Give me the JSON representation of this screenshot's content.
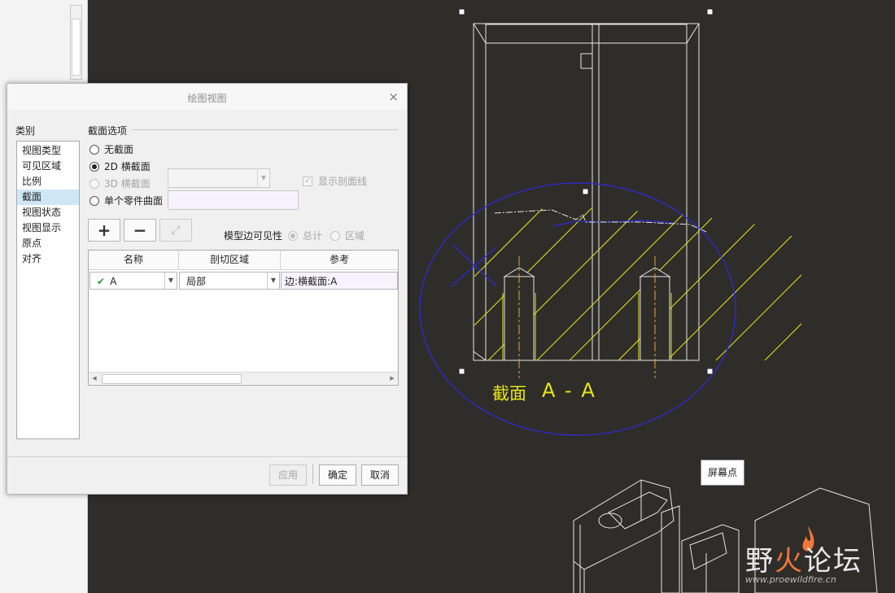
{
  "dialog": {
    "title": "绘图视图",
    "close_glyph": "×",
    "category_label": "类别",
    "categories": [
      "视图类型",
      "可见区域",
      "比例",
      "截面",
      "视图状态",
      "视图显示",
      "原点",
      "对齐"
    ],
    "selected_category": "截面",
    "section_options_title": "截面选项",
    "options": {
      "no_section": "无截面",
      "section_2d": "2D 横截面",
      "section_3d": "3D 横截面",
      "single_part_surface": "单个零件曲面"
    },
    "selected_option": "2D 横截面",
    "show_hatch_label": "显示剖面线",
    "toolbar": {
      "add": "+",
      "remove": "−",
      "flip": "⤢"
    },
    "model_edge_visibility_label": "模型边可见性",
    "visibility_options": {
      "total": "总计",
      "area": "区域"
    },
    "table": {
      "columns": [
        "名称",
        "剖切区域",
        "参考"
      ],
      "rows": [
        {
          "name": "A",
          "region": "局部",
          "reference": "边:横截面:A",
          "status_glyph": "✔"
        }
      ]
    },
    "buttons": {
      "apply": "应用",
      "ok": "确定",
      "cancel": "取消"
    }
  },
  "canvas": {
    "section_label": "截面",
    "section_name": "A - A",
    "tooltip": "屏幕点",
    "colors": {
      "background": "#2f2d29",
      "geometry": "#e6e6e6",
      "hatch": "#e5e51a",
      "sketch": "#2b2bd6"
    }
  },
  "watermark": {
    "brand_part1": "野",
    "brand_part2": "火",
    "brand_part3": "论坛",
    "url": "www.proewildfire.cn"
  }
}
